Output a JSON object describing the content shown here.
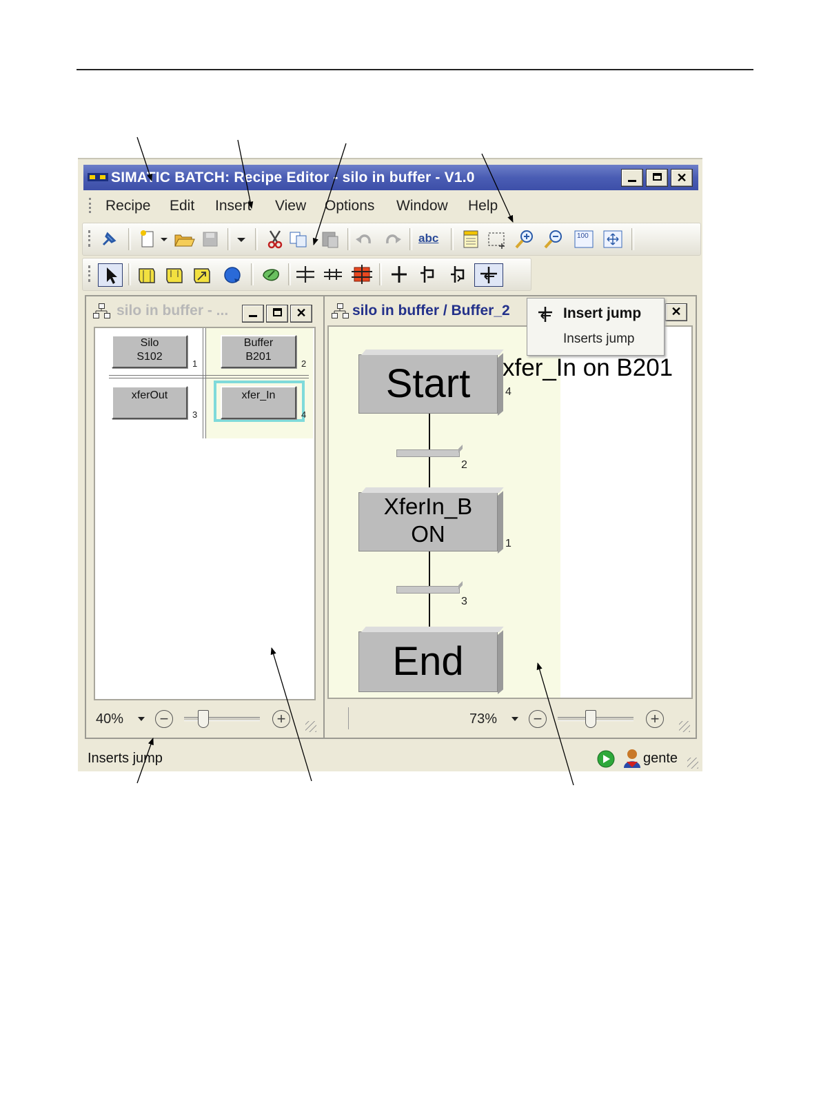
{
  "app": {
    "title": "SIMATIC BATCH: Recipe Editor - silo in buffer - V1.0"
  },
  "menu": {
    "items": [
      "Recipe",
      "Edit",
      "Insert",
      "View",
      "Options",
      "Window",
      "Help"
    ]
  },
  "toolbar_icons": {
    "standard": [
      "pin-icon",
      "new-document-icon",
      "dropdown-arrow-icon",
      "open-folder-icon",
      "save-icon",
      "dropdown-arrow-icon",
      "cut-icon",
      "copy-icon",
      "paste-icon",
      "undo-icon",
      "redo-icon",
      "spell-check-icon",
      "properties-icon",
      "select-rectangle-icon",
      "zoom-in-icon",
      "zoom-out-icon",
      "zoom-100-icon",
      "zoom-fit-icon"
    ],
    "insert": [
      "pointer-icon",
      "insert-step-icon",
      "insert-step-icon",
      "insert-step-icon",
      "insert-loop-icon",
      "insert-operation-icon",
      "insert-sequence-icon",
      "insert-parallel-icon",
      "insert-synchronization-icon",
      "insert-step-transition-icon",
      "insert-branch-icon",
      "insert-jump-back-icon",
      "insert-jump-icon"
    ],
    "spell_check_label": "abc",
    "zoom_100_label": "100"
  },
  "left_window": {
    "title": "silo in buffer - ...",
    "units": [
      {
        "label": "Silo\nS102",
        "num": "1"
      },
      {
        "label": "Buffer\nB201",
        "num": "2"
      },
      {
        "label": "xferOut",
        "num": "3"
      },
      {
        "label": "xfer_In",
        "num": "4"
      }
    ],
    "zoom": "40%"
  },
  "right_window": {
    "title": "silo in buffer / Buffer_2",
    "caption": "xfer_In on B201",
    "steps": [
      {
        "label": "Start",
        "num": "4"
      },
      {
        "label": "XferIn_B\nON",
        "num": "1"
      },
      {
        "label": "End",
        "num": ""
      }
    ],
    "transitions": [
      "2",
      "3"
    ],
    "zoom": "73%"
  },
  "tooltip": {
    "title": "Insert jump",
    "text": "Inserts jump"
  },
  "status": {
    "text": "Inserts jump",
    "user": "gente"
  },
  "colors": {
    "title_blue": "#4a5db4",
    "step_fill": "#bcbcbc",
    "container_yellow": "#f8fae4",
    "selected_cyan": "#7fdada",
    "run_green": "#2ea83a"
  }
}
